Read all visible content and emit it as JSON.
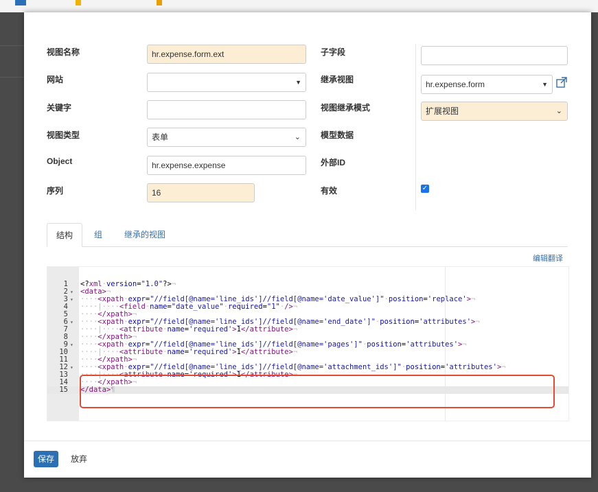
{
  "form": {
    "view_name_label": "视图名称",
    "view_name_value": "hr.expense.form.ext",
    "website_label": "网站",
    "website_value": "",
    "key_label": "关键字",
    "key_value": "",
    "view_type_label": "视图类型",
    "view_type_value": "表单",
    "object_label": "Object",
    "object_value": "hr.expense.expense",
    "sequence_label": "序列",
    "sequence_value": "16",
    "child_field_label": "子字段",
    "child_field_value": "",
    "inherit_view_label": "继承视图",
    "inherit_view_value": "hr.expense.form",
    "inherit_mode_label": "视图继承模式",
    "inherit_mode_value": "扩展视图",
    "model_data_label": "模型数据",
    "external_id_label": "外部ID",
    "active_label": "有效",
    "active_checked": true
  },
  "tabs": [
    "结构",
    "组",
    "继承的视图"
  ],
  "edit_translation_label": "编辑翻译",
  "code_lines": [
    {
      "n": "1",
      "fold": "",
      "html": "<span class='t-pi'>&lt;?</span><span class='t-tag'>xml</span><span class='t-ws'>·</span><span class='t-attr'>version</span>=<span class='t-str'>\"1.0\"</span><span class='t-pi'>?&gt;</span><span class='t-ws'>¬</span>"
    },
    {
      "n": "2",
      "fold": "▾",
      "html": "<span class='t-tag'>&lt;data&gt;</span><span class='t-ws'>¬</span>"
    },
    {
      "n": "3",
      "fold": "▾",
      "html": "<span class='t-ws'>····</span><span class='t-tag'>&lt;xpath</span><span class='t-ws'>·</span><span class='t-attr'>expr</span>=<span class='t-str'>\"//field[@name='line_ids']//field[@name='date_value']\"</span><span class='t-ws'>·</span><span class='t-attr'>position</span>=<span class='t-str'>'replace'</span><span class='t-tag'>&gt;</span><span class='t-ws'>¬</span>"
    },
    {
      "n": "4",
      "fold": "",
      "html": "<span class='t-ws'>····|····</span><span class='t-tag'>&lt;field</span><span class='t-ws'>·</span><span class='t-attr'>name</span>=<span class='t-str'>\"date_value\"</span><span class='t-ws'>·</span><span class='t-attr'>required</span>=<span class='t-str'>\"1\"</span><span class='t-ws'>·</span><span class='t-tag'>/&gt;</span><span class='t-ws'>¬</span>"
    },
    {
      "n": "5",
      "fold": "",
      "html": "<span class='t-ws'>····</span><span class='t-tag'>&lt;/xpath&gt;</span><span class='t-ws'>¬</span>"
    },
    {
      "n": "6",
      "fold": "▾",
      "html": "<span class='t-ws'>····</span><span class='t-tag'>&lt;xpath</span><span class='t-ws'>·</span><span class='t-attr'>expr</span>=<span class='t-str'>\"//field[@name='line_ids']//field[@name='end_date']\"</span><span class='t-ws'>·</span><span class='t-attr'>position</span>=<span class='t-str'>'attributes'</span><span class='t-tag'>&gt;</span><span class='t-ws'>¬</span>"
    },
    {
      "n": "7",
      "fold": "",
      "html": "<span class='t-ws'>····|····</span><span class='t-tag'>&lt;attribute</span><span class='t-ws'>·</span><span class='t-attr'>name</span>=<span class='t-str'>'required'</span><span class='t-tag'>&gt;</span>1<span class='t-tag'>&lt;/attribute&gt;</span><span class='t-ws'>¬</span>"
    },
    {
      "n": "8",
      "fold": "",
      "html": "<span class='t-ws'>····</span><span class='t-tag'>&lt;/xpath&gt;</span><span class='t-ws'>¬</span>"
    },
    {
      "n": "9",
      "fold": "▾",
      "html": "<span class='t-ws'>····</span><span class='t-tag'>&lt;xpath</span><span class='t-ws'>·</span><span class='t-attr'>expr</span>=<span class='t-str'>\"//field[@name='line_ids']//field[@name='pages']\"</span><span class='t-ws'>·</span><span class='t-attr'>position</span>=<span class='t-str'>'attributes'</span><span class='t-tag'>&gt;</span><span class='t-ws'>¬</span>"
    },
    {
      "n": "10",
      "fold": "",
      "html": "<span class='t-ws'>····|····</span><span class='t-tag'>&lt;attribute</span><span class='t-ws'>·</span><span class='t-attr'>name</span>=<span class='t-str'>'required'</span><span class='t-tag'>&gt;</span>1<span class='t-tag'>&lt;/attribute&gt;</span><span class='t-ws'>¬</span>"
    },
    {
      "n": "11",
      "fold": "",
      "html": "<span class='t-ws'>····</span><span class='t-tag'>&lt;/xpath&gt;</span><span class='t-ws'>¬</span>"
    },
    {
      "n": "12",
      "fold": "▾",
      "html": "<span class='t-ws'>····</span><span class='t-tag'>&lt;xpath</span><span class='t-ws'>·</span><span class='t-attr'>expr</span>=<span class='t-str'>\"//field[@name='line_ids']//field[@name='attachment_ids']\"</span><span class='t-ws'>·</span><span class='t-attr'>position</span>=<span class='t-str'>'attributes'</span><span class='t-tag'>&gt;</span><span class='t-ws'>¬</span>"
    },
    {
      "n": "13",
      "fold": "",
      "html": "<span class='t-ws'>····|····</span><span class='t-tag'>&lt;attribute</span><span class='t-ws'>·</span><span class='t-attr'>name</span>=<span class='t-str'>'required'</span><span class='t-tag'>&gt;</span>1<span class='t-tag'>&lt;/attribute&gt;</span><span class='t-ws'>¬</span>"
    },
    {
      "n": "14",
      "fold": "",
      "html": "<span class='t-ws'>····</span><span class='t-tag'>&lt;/xpath&gt;</span><span class='t-ws'>¬</span>"
    },
    {
      "n": "15",
      "fold": "",
      "html": "<span class='t-tag'>&lt;/data&gt;</span><span class='t-ws'>¶</span>"
    }
  ],
  "active_line": "15",
  "footer": {
    "save_label": "保存",
    "discard_label": "放弃"
  },
  "colors": {
    "required_bg": "#fbeed5",
    "primary": "#2c6fb2",
    "highlight": "#e24b32",
    "link": "#3a6ea5"
  },
  "icons": {
    "external_link": "external-link-icon",
    "dropdown": "caret-down-icon",
    "checkbox": "check-icon"
  }
}
